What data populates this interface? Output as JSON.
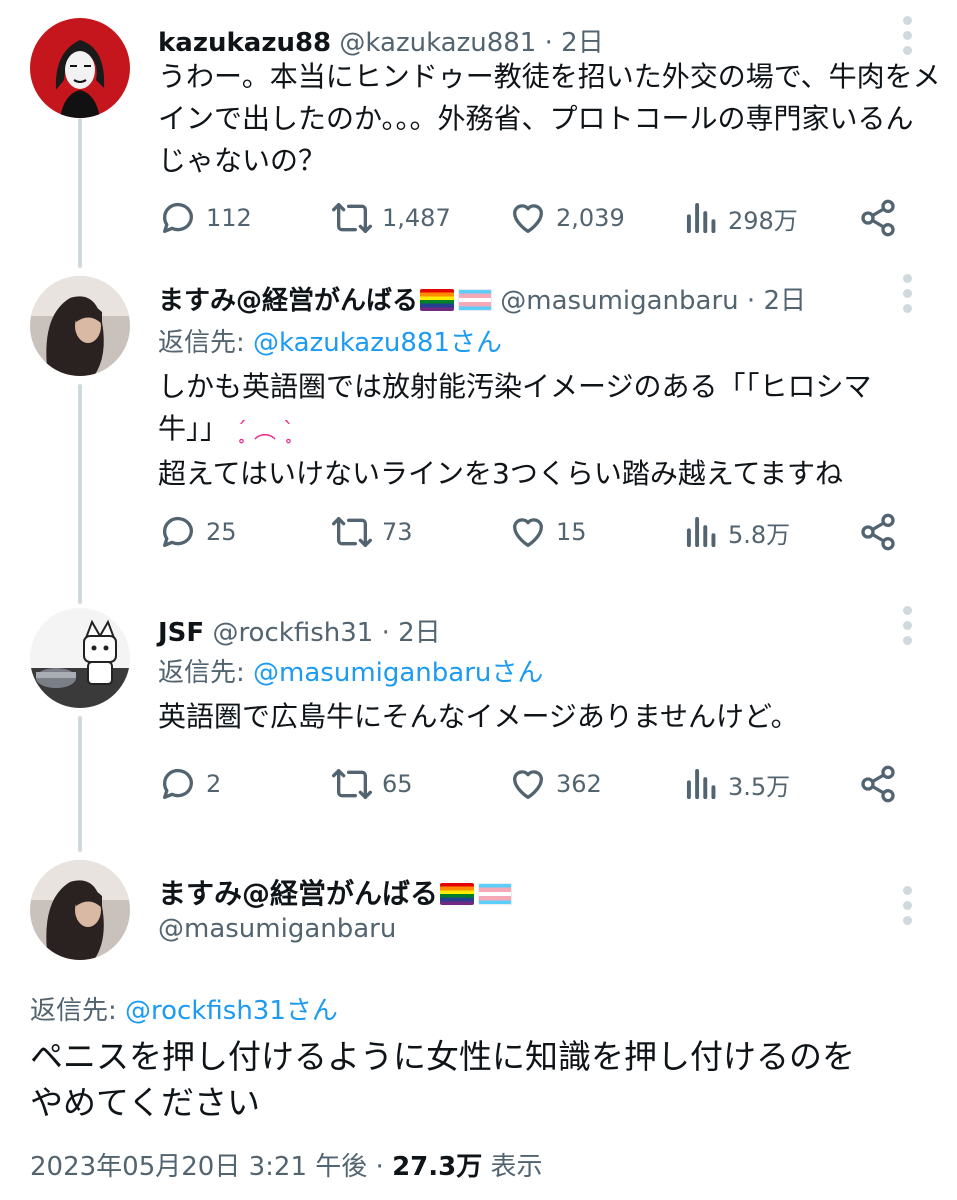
{
  "tweets": [
    {
      "name": "kazukazu88",
      "handle": "@kazukazu881",
      "time": "2日",
      "text_lines": [
        "うわー。本当にヒンドゥー教徒を招いた外交の場で、牛肉をメ",
        "インで出したのか。。。外務省、プロトコールの専門家いるん",
        "じゃないの？"
      ],
      "replies": "112",
      "retweets": "1,487",
      "likes": "2,039",
      "views": "298万"
    },
    {
      "name": "ますみ@経営がんばる",
      "handle": "@masumiganbaru",
      "time": "2日",
      "reply_prefix": "返信先: ",
      "reply_to": "@kazukazu881さん",
      "text_lines": [
        "しかも英語圏では放射能汚染イメージのある「「ヒロシマ",
        "牛」」",
        "超えてはいけないラインを3つくらい踏み越えてますね"
      ],
      "emoji": "ˊ̥ ︵ ˋ̥",
      "replies": "25",
      "retweets": "73",
      "likes": "15",
      "views": "5.8万"
    },
    {
      "name": "JSF",
      "handle": "@rockfish31",
      "time": "2日",
      "reply_prefix": "返信先: ",
      "reply_to": "@masumiganbaruさん",
      "text_lines": [
        "英語圏で広島牛にそんなイメージありませんけど。"
      ],
      "replies": "2",
      "retweets": "65",
      "likes": "362",
      "views": "3.5万"
    }
  ],
  "focused": {
    "name": "ますみ@経営がんばる",
    "handle": "@masumiganbaru",
    "reply_prefix": "返信先: ",
    "reply_to": "@rockfish31さん",
    "text_lines": [
      "ペニスを押し付けるように女性に知識を押し付けるのを",
      "やめてください"
    ],
    "date": "2023年05月20日 3:21 午後",
    "sep": " · ",
    "views_count": "27.3万",
    "views_label": " 表示"
  },
  "separator": " · ",
  "colors": {
    "text": "#0f1419",
    "muted": "#536471",
    "link": "#1d9bf0",
    "thread_line": "#cfd9de"
  },
  "icons": [
    "reply-icon",
    "retweet-icon",
    "like-icon",
    "views-icon",
    "share-icon",
    "more-icon"
  ]
}
